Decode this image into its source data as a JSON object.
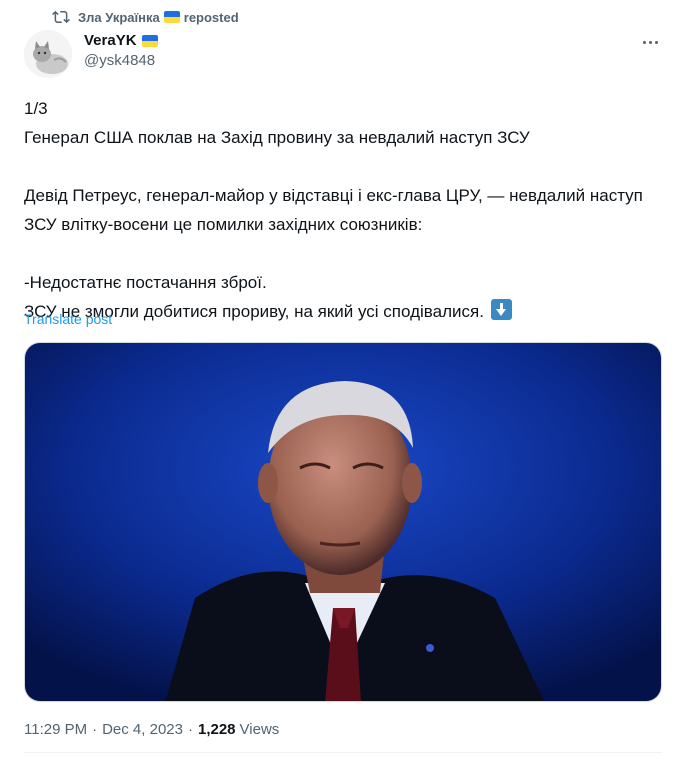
{
  "repost": {
    "reposter": "Зла Українка",
    "label": "reposted"
  },
  "author": {
    "name": "VeraYK",
    "handle": "@ysk4848"
  },
  "post": {
    "paragraphs": [
      "1/3\nГенерал США поклав на Захід провину за невдалий наступ ЗСУ",
      "Девід Петреус, генерал-майор у відставці і екс-глава ЦРУ, — невдалий наступ ЗСУ влітку-восени це помилки західних союзників:",
      "-Недостатнє постачання зброї.\nЗСУ не змогли добитися прориву, на який усі сподівалися."
    ],
    "translate_label": "Translate post"
  },
  "meta": {
    "time": "11:29 PM",
    "date": "Dec 4, 2023",
    "views_count": "1,228",
    "views_label": "Views",
    "separator": "·"
  },
  "icons": {
    "repost": "repost-icon",
    "flag": "ukraine-flag-icon",
    "more": "more-options-icon",
    "emoji": "down-arrow-emoji-icon"
  },
  "colors": {
    "text": "#0f1419",
    "muted": "#536471",
    "link": "#1d9bf0",
    "media_bg": "#0b2a8f"
  }
}
